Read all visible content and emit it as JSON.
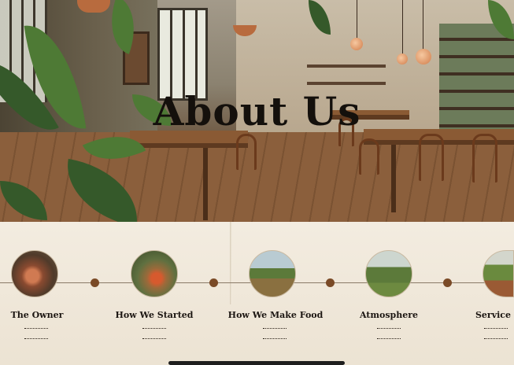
{
  "hero": {
    "title": "About Us"
  },
  "timeline": {
    "items": [
      {
        "label": "The Owner",
        "icon": "portrait-photo"
      },
      {
        "label": "How We Started",
        "icon": "garden-photo"
      },
      {
        "label": "How We Make Food",
        "icon": "farm-photo"
      },
      {
        "label": "Atmosphere",
        "icon": "field-photo"
      },
      {
        "label": "Service",
        "icon": "vegetable-garden-photo"
      }
    ]
  },
  "colors": {
    "accent_dot": "#7a4a26",
    "section_background": "#f3ece0",
    "title_text": "#14100c"
  }
}
